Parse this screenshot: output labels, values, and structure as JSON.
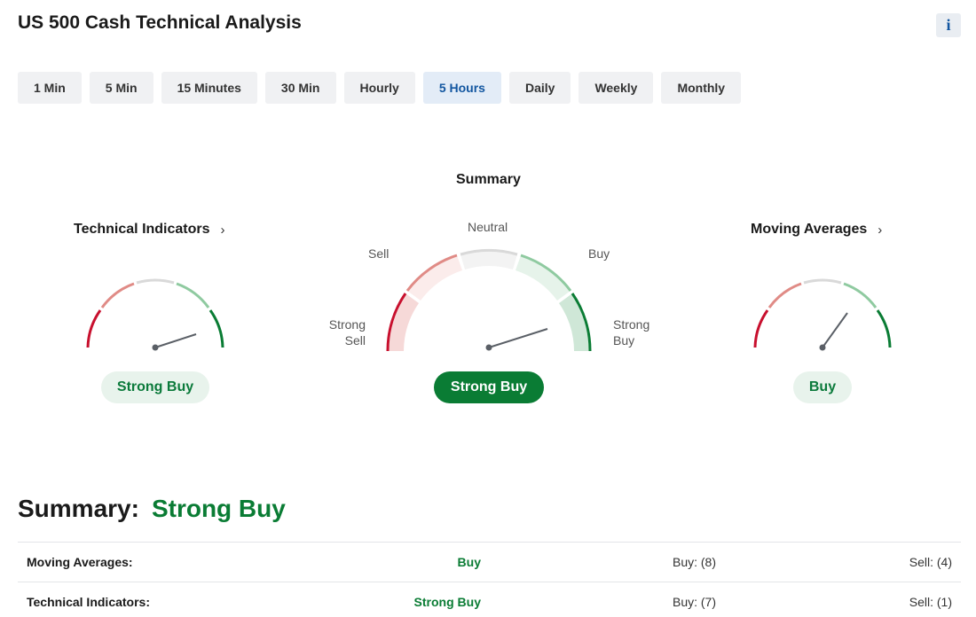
{
  "header": {
    "title": "US 500 Cash Technical Analysis",
    "info_label": "i"
  },
  "tabs": [
    {
      "label": "1 Min",
      "active": false
    },
    {
      "label": "5 Min",
      "active": false
    },
    {
      "label": "15 Minutes",
      "active": false
    },
    {
      "label": "30 Min",
      "active": false
    },
    {
      "label": "Hourly",
      "active": false
    },
    {
      "label": "5 Hours",
      "active": true
    },
    {
      "label": "Daily",
      "active": false
    },
    {
      "label": "Weekly",
      "active": false
    },
    {
      "label": "Monthly",
      "active": false
    }
  ],
  "gauges": {
    "technical": {
      "title": "Technical Indicators",
      "chevron": "›",
      "result": "Strong Buy"
    },
    "summary": {
      "title": "Summary",
      "result": "Strong Buy",
      "labels": {
        "strong_sell": "Strong\nSell",
        "sell": "Sell",
        "neutral": "Neutral",
        "buy": "Buy",
        "strong_buy": "Strong\nBuy"
      }
    },
    "moving": {
      "title": "Moving Averages",
      "chevron": "›",
      "result": "Buy"
    }
  },
  "summary": {
    "label": "Summary:",
    "value": "Strong Buy",
    "rows": [
      {
        "name": "Moving Averages:",
        "value": "Buy",
        "buy": "Buy: (8)",
        "sell": "Sell: (4)"
      },
      {
        "name": "Technical Indicators:",
        "value": "Strong Buy",
        "buy": "Buy: (7)",
        "sell": "Sell: (1)"
      }
    ]
  },
  "colors": {
    "strong_sell": "#c8102e",
    "sell": "#e08b86",
    "neutral": "#d9d9d9",
    "buy": "#8fcaa0",
    "strong_buy": "#0a7c34",
    "accent": "#1256a0"
  }
}
